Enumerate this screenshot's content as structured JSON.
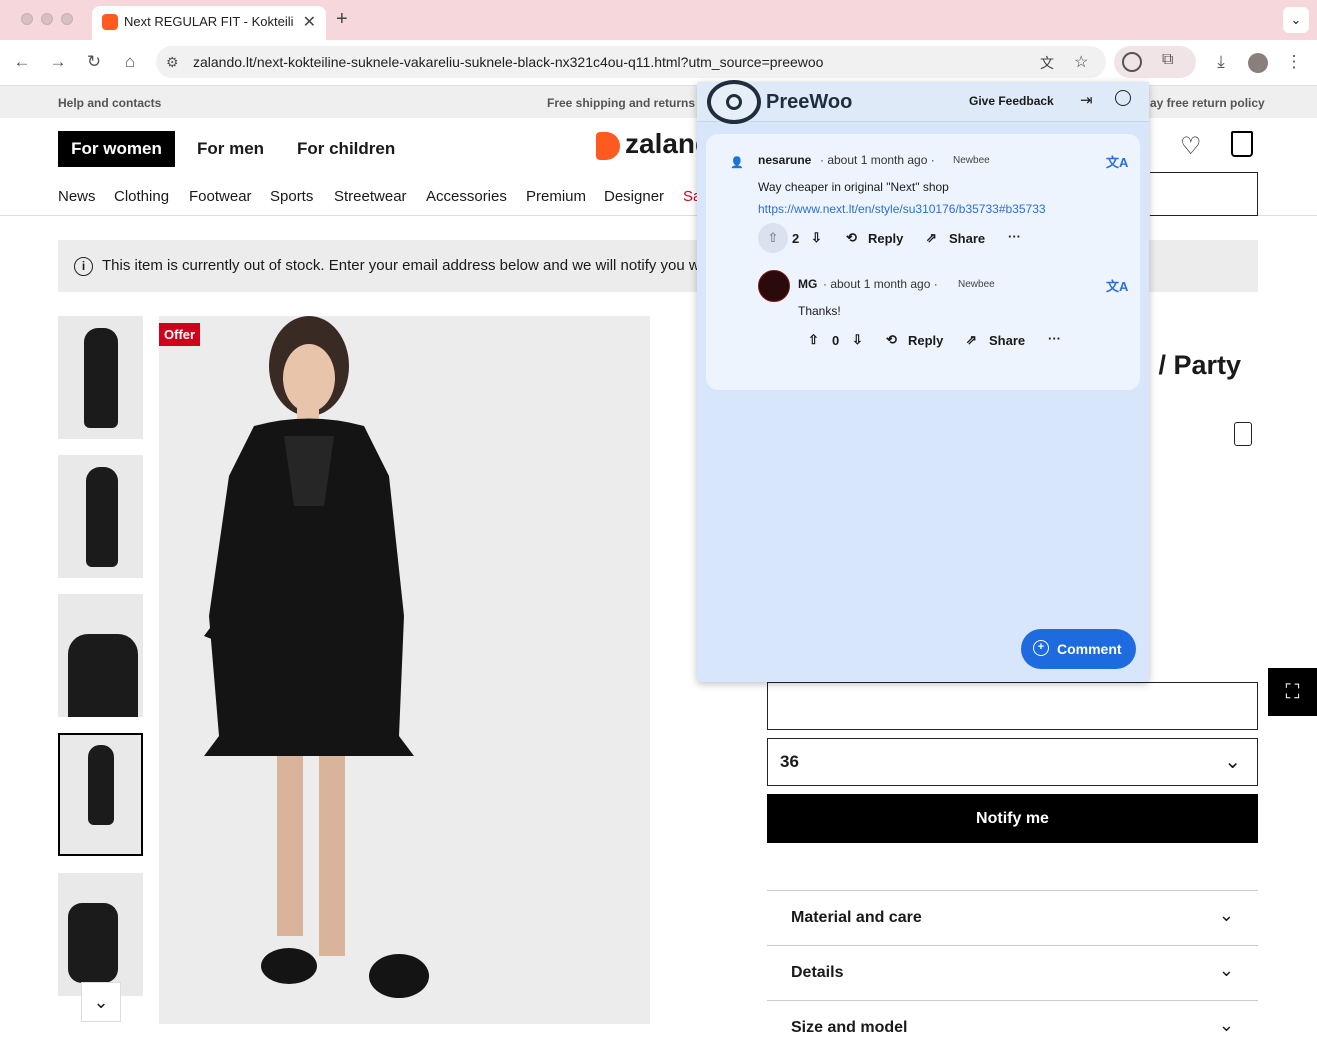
{
  "browser": {
    "tab_title": "Next REGULAR FIT - Kokteiline suknele",
    "url": "zalando.lt/next-kokteiline-suknele-vakareliu-suknele-black-nx321c4ou-q11.html?utm_source=preewoo",
    "new_tab_symbol": "+",
    "close_symbol": "✕"
  },
  "topbar": {
    "help": "Help and contacts",
    "shipping": "Free shipping and returns f",
    "returns": "ay free return policy"
  },
  "header": {
    "genders": [
      "For women",
      "For men",
      "For children"
    ],
    "logo_text": "zalando",
    "categories": [
      "News",
      "Clothing",
      "Footwear",
      "Sports",
      "Streetwear",
      "Accessories",
      "Premium",
      "Designer",
      "Sa"
    ]
  },
  "notice": {
    "text": "This item is currently out of stock. Enter your email address below and we will notify you wh"
  },
  "product": {
    "offer_badge": "Offer",
    "title_partial": "/ Party",
    "title_prefix_glyph": ";",
    "size_value": "36",
    "notify_button": "Notify me",
    "accordions": [
      "Material and care",
      "Details",
      "Size and model"
    ]
  },
  "preewoo": {
    "brand": "PreeWoo",
    "feedback": "Give Feedback",
    "comments": [
      {
        "author": "nesarune",
        "time": "· about 1 month ago ·",
        "badge": "Newbee",
        "text": "Way cheaper in original \"Next\" shop",
        "link": "https://www.next.lt/en/style/su310176/b35733#b35733",
        "votes": "2",
        "reply": "Reply",
        "share": "Share"
      },
      {
        "author": "MG",
        "time": "· about 1 month ago ·",
        "badge": "Newbee",
        "text": "Thanks!",
        "votes": "0",
        "reply": "Reply",
        "share": "Share"
      }
    ],
    "comment_button": "Comment"
  },
  "colors": {
    "tabstrip": "#f6d8dc",
    "accent_blue": "#1e6be0",
    "offer_red": "#d0021b",
    "zalando_orange": "#ff5a1f",
    "panel_bg": "#d7e6fb"
  }
}
